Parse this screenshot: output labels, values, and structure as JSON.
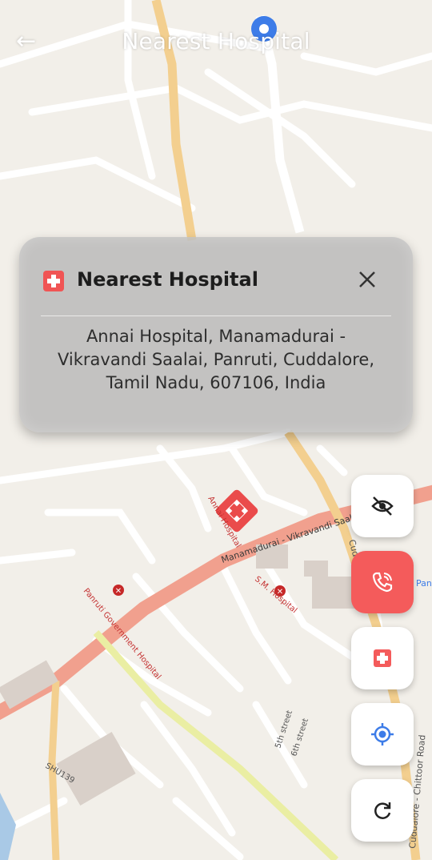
{
  "header": {
    "title": "Nearest Hospital",
    "back_icon": "arrow-back-icon"
  },
  "map": {
    "road_labels": [
      "Manamadurai - Vikravandi Saalai",
      "5th street",
      "6th street",
      "Cuddalore - Chittoor Road",
      "Cudd...",
      "SHU139"
    ],
    "places": [
      "Annai Hospital",
      "S.M. Hospital",
      "Panruti Government Hospital",
      "Panru..."
    ],
    "user_location_icon": "location-pin-icon"
  },
  "hospital_card": {
    "title": "Nearest Hospital",
    "address": "Annai Hospital, Manamadurai - Vikravandi Saalai, Panruti, Cuddalore, Tamil Nadu, 607106, India",
    "icon": "hospital-cross-icon",
    "close_icon": "close-icon"
  },
  "actions": [
    {
      "name": "toggle-visibility-button",
      "icon": "eye-off-icon"
    },
    {
      "name": "call-button",
      "icon": "phone-call-icon"
    },
    {
      "name": "hospital-button",
      "icon": "hospital-cross-icon"
    },
    {
      "name": "my-location-button",
      "icon": "crosshair-icon"
    },
    {
      "name": "refresh-button",
      "icon": "refresh-icon"
    }
  ],
  "colors": {
    "accent": "#f45b5b",
    "map_bg": "#f2efe9",
    "main_road": "#f1a08e",
    "secondary_road": "#f3cf8f",
    "tertiary_road": "#eaeea3",
    "blue_accent": "#3d7ce8"
  }
}
